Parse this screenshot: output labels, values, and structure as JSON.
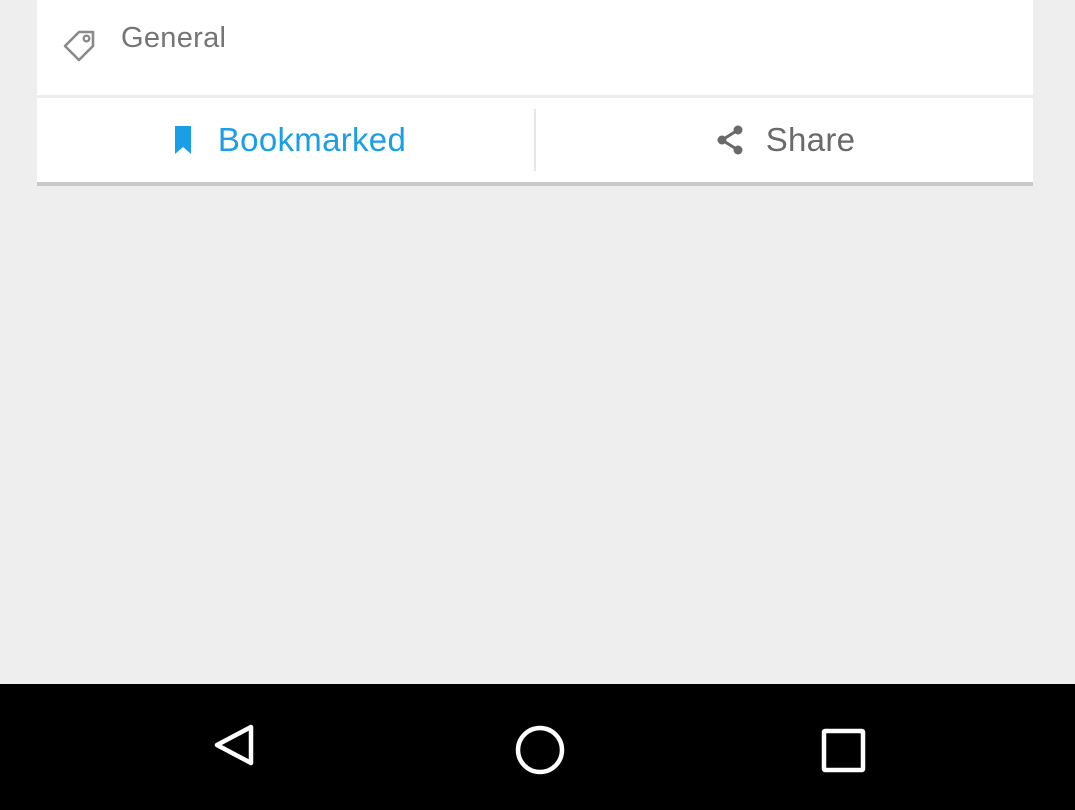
{
  "card": {
    "tag_label": "General",
    "tag_icon": "tag-icon",
    "actions": {
      "bookmark": {
        "label": "Bookmarked",
        "icon": "bookmark-icon",
        "color": "#1a9ee5"
      },
      "share": {
        "label": "Share",
        "icon": "share-icon",
        "color": "#6a6a6a"
      }
    }
  },
  "navbar": {
    "back_icon": "back-triangle-icon",
    "home_icon": "home-circle-icon",
    "recents_icon": "recents-square-icon"
  },
  "colors": {
    "background": "#eeeeee",
    "card": "#ffffff",
    "accent": "#1a9ee5",
    "navbar": "#000000"
  }
}
